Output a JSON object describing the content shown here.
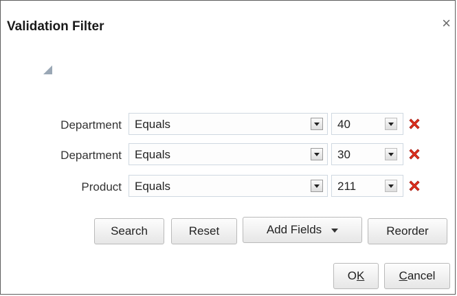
{
  "dialog": {
    "title": "Validation Filter",
    "close_glyph": "×"
  },
  "rows": [
    {
      "label": "Department",
      "operator": "Equals",
      "value": "40"
    },
    {
      "label": "Department",
      "operator": "Equals",
      "value": "30"
    },
    {
      "label": "Product",
      "operator": "Equals",
      "value": "211"
    }
  ],
  "buttons": {
    "search": "Search",
    "reset": "Reset",
    "add_fields": "Add Fields",
    "reorder": "Reorder",
    "ok_prefix": "O",
    "ok_mnemonic": "K",
    "cancel_mnemonic": "C",
    "cancel_suffix": "ancel"
  },
  "icons": {
    "disclosure": "disclosure-triangle-icon",
    "remove": "remove-x-icon",
    "dropdown": "chevron-down-icon"
  },
  "colors": {
    "remove_red": "#e0301e",
    "field_border": "#cfd8e1",
    "disclosure": "#9aa7b5"
  }
}
